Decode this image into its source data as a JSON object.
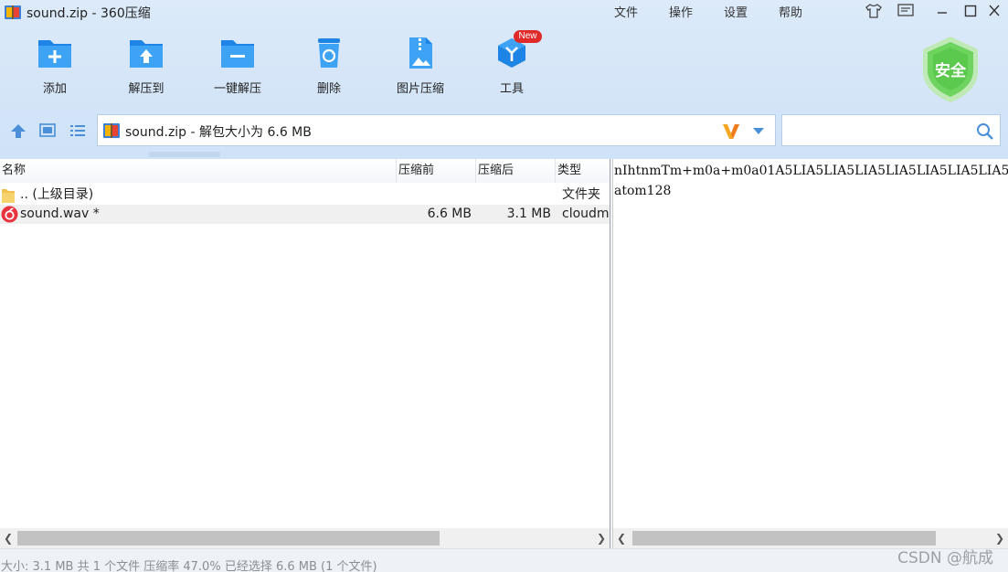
{
  "window": {
    "title": "sound.zip - 360压缩",
    "menu": [
      "文件",
      "操作",
      "设置",
      "帮助"
    ]
  },
  "toolbar": {
    "items": [
      {
        "label": "添加",
        "icon": "add-folder-icon"
      },
      {
        "label": "解压到",
        "icon": "extract-to-icon"
      },
      {
        "label": "一键解压",
        "icon": "one-click-extract-icon"
      },
      {
        "label": "删除",
        "icon": "recycle-bin-icon"
      },
      {
        "label": "图片压缩",
        "icon": "image-compress-icon"
      },
      {
        "label": "工具",
        "icon": "tools-icon"
      }
    ],
    "new_badge": "New",
    "security_label": "安全"
  },
  "address": {
    "path": "sound.zip - 解包大小为 6.6 MB",
    "search_placeholder": ""
  },
  "file_list": {
    "columns": [
      "名称",
      "压缩前",
      "压缩后",
      "类型"
    ],
    "rows": [
      {
        "name": ".. (上级目录)",
        "before": "",
        "after": "",
        "type": "文件夹",
        "icon": "folder-icon"
      },
      {
        "name": "sound.wav *",
        "before": "6.6 MB",
        "after": "3.1 MB",
        "type": "cloudmusic",
        "icon": "netease-cloudmusic-icon"
      }
    ]
  },
  "comment": {
    "lines": [
      "nIhtnmTm+m0a+m0a01A5LIA5LIA5LIA5LIA5LIA5LIA5LIA5",
      "atom128"
    ]
  },
  "status": {
    "text": "大小: 3.1 MB 共 1 个文件 压缩率 47.0% 已经选择 6.6 MB (1 个文件)"
  },
  "watermark": "CSDN @航成",
  "colors": {
    "accent": "#2b8ee8",
    "chrome_bg": "#d4e5f8",
    "badge_red": "#e02a2a",
    "shield_green": "#54c64a"
  }
}
